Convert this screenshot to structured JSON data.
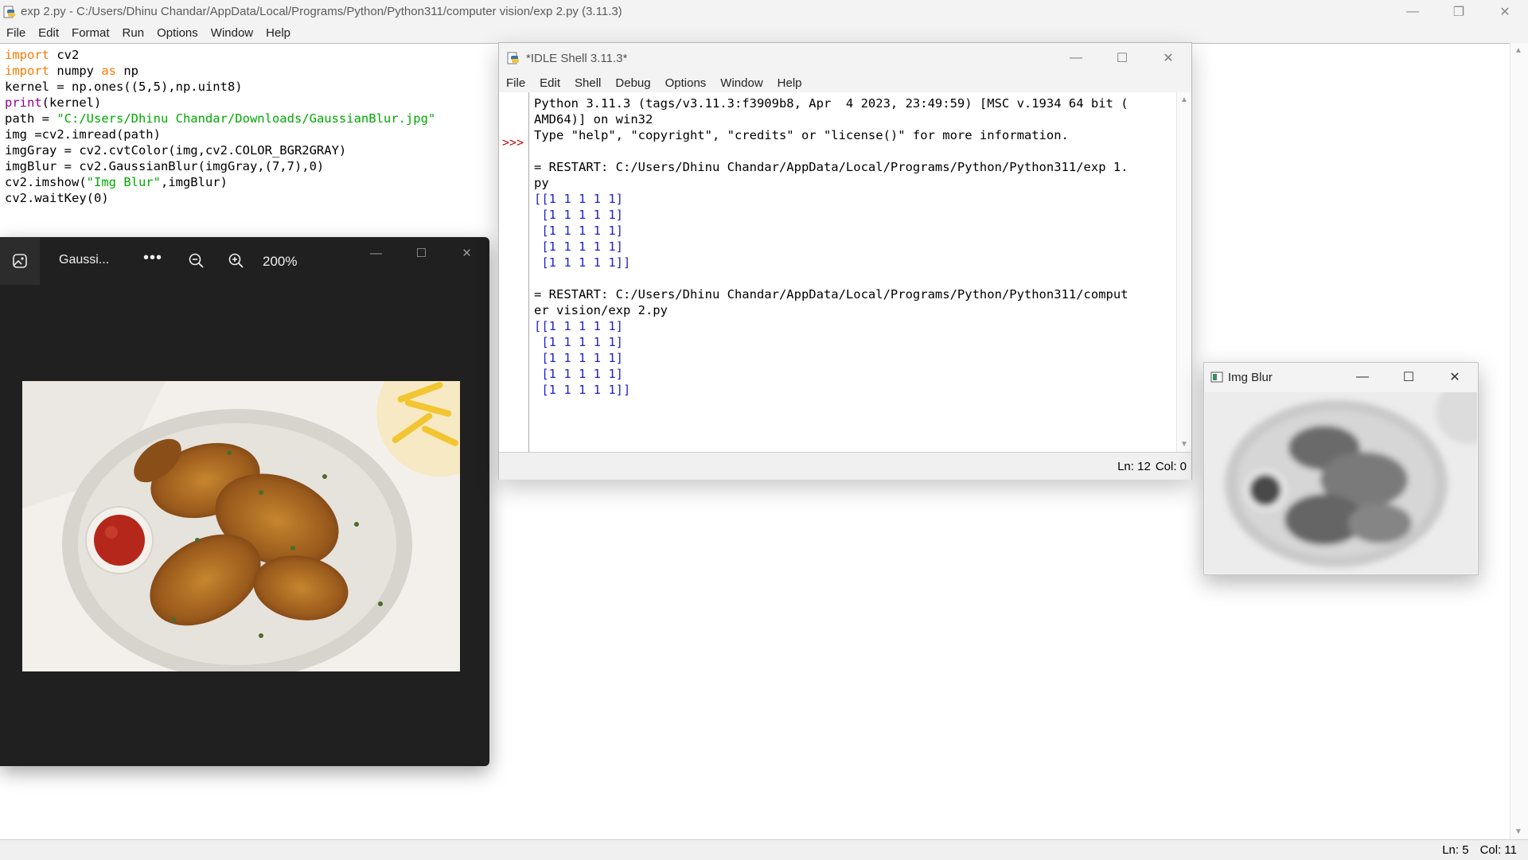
{
  "editor": {
    "title": "exp 2.py - C:/Users/Dhinu Chandar/AppData/Local/Programs/Python/Python311/computer vision/exp 2.py (3.11.3)",
    "menu": [
      "File",
      "Edit",
      "Format",
      "Run",
      "Options",
      "Window",
      "Help"
    ],
    "code": {
      "l1_kw": "import",
      "l1_rest": " cv2",
      "l2_kw": "import",
      "l2_mid": " numpy ",
      "l2_kw2": "as",
      "l2_rest": " np",
      "l3": "kernel = np.ones((5,5),np.uint8)",
      "l4_bi": "print",
      "l4_rest": "(kernel)",
      "l5_pre": "path = ",
      "l5_str": "\"C:/Users/Dhinu Chandar/Downloads/GaussianBlur.jpg\"",
      "l6": "img =cv2.imread(path)",
      "l7": "imgGray = cv2.cvtColor(img,cv2.COLOR_BGR2GRAY)",
      "l8": "imgBlur = cv2.GaussianBlur(imgGray,(7,7),0)",
      "l9_pre": "cv2.imshow(",
      "l9_str": "\"Img Blur\"",
      "l9_rest": ",imgBlur)",
      "l10": "cv2.waitKey(0)"
    },
    "status": {
      "line": "Ln: 5",
      "col": "Col: 11"
    }
  },
  "photos": {
    "filename": "Gaussi...",
    "more": "•••",
    "zoom": "200%"
  },
  "shell": {
    "title": "*IDLE Shell 3.11.3*",
    "menu": [
      "File",
      "Edit",
      "Shell",
      "Debug",
      "Options",
      "Window",
      "Help"
    ],
    "prompt": ">>>",
    "banner1": "Python 3.11.3 (tags/v3.11.3:f3909b8, Apr  4 2023, 23:49:59) [MSC v.1934 64 bit (",
    "banner2": "AMD64)] on win32",
    "banner3": "Type \"help\", \"copyright\", \"credits\" or \"license()\" for more information.",
    "restart1a": "= RESTART: C:/Users/Dhinu Chandar/AppData/Local/Programs/Python/Python311/exp 1.",
    "restart1b": "py",
    "out1": [
      "[[1 1 1 1 1]",
      " [1 1 1 1 1]",
      " [1 1 1 1 1]",
      " [1 1 1 1 1]",
      " [1 1 1 1 1]]"
    ],
    "restart2a": "= RESTART: C:/Users/Dhinu Chandar/AppData/Local/Programs/Python/Python311/comput",
    "restart2b": "er vision/exp 2.py",
    "out2": [
      "[[1 1 1 1 1]",
      " [1 1 1 1 1]",
      " [1 1 1 1 1]",
      " [1 1 1 1 1]",
      " [1 1 1 1 1]]"
    ],
    "status": {
      "line": "Ln: 12",
      "col": "Col: 0"
    }
  },
  "blur": {
    "title": "Img Blur"
  },
  "icons": {
    "minimize": "minimize-icon",
    "maximize": "maximize-icon",
    "restore": "restore-icon",
    "close": "close-icon"
  }
}
